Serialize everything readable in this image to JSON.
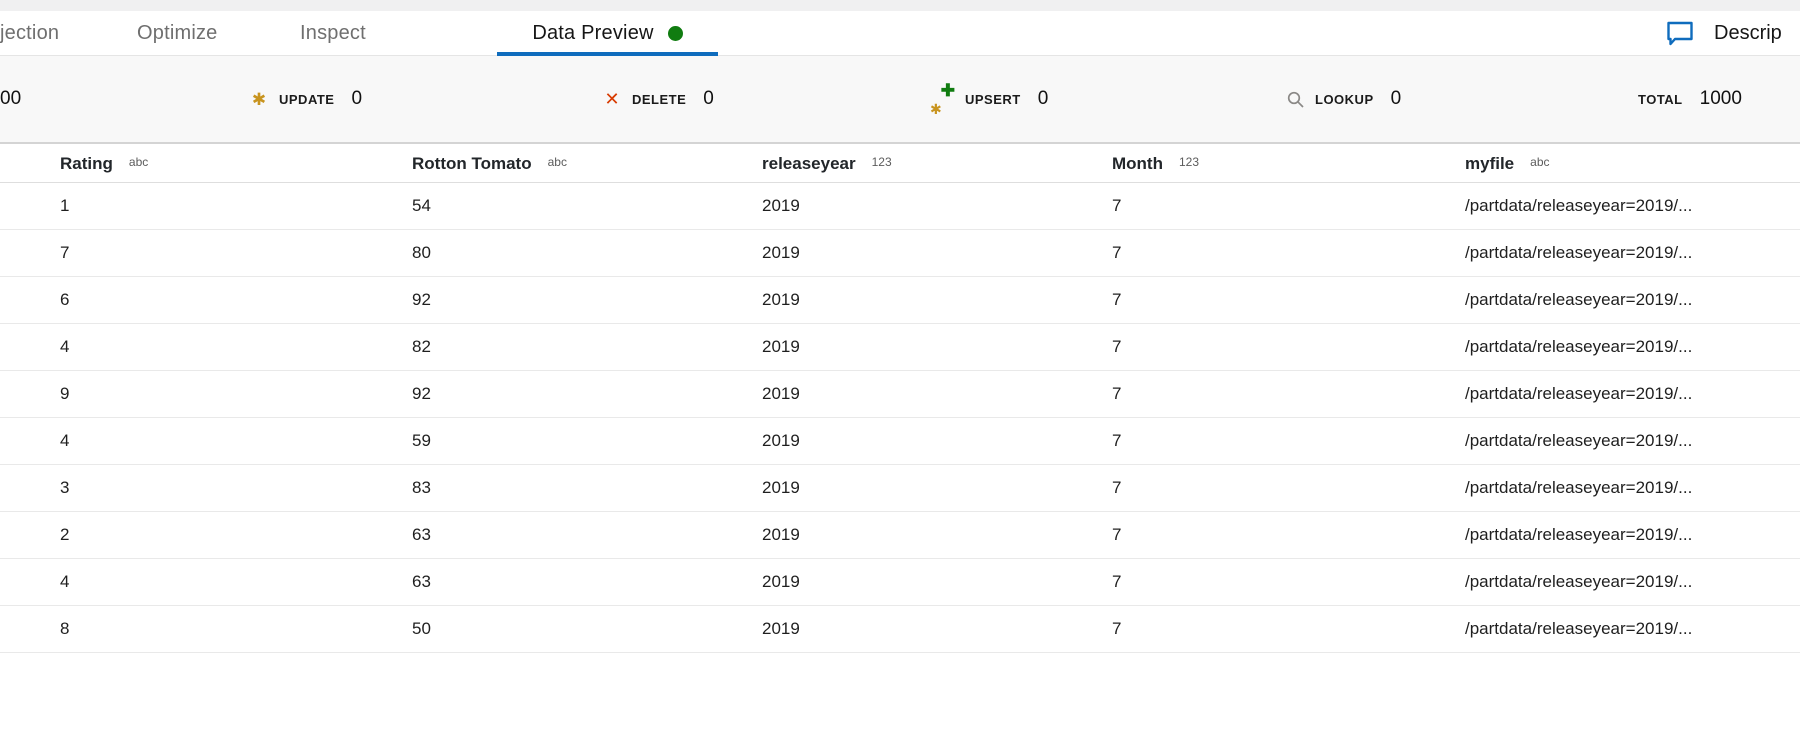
{
  "tabs": {
    "items": [
      {
        "label": "jection",
        "active": false
      },
      {
        "label": "Optimize",
        "active": false
      },
      {
        "label": "Inspect",
        "active": false
      },
      {
        "label": "Data Preview",
        "active": true,
        "has_status_dot": true
      }
    ],
    "description_button": {
      "label": "Descrip",
      "icon": "comment-icon"
    }
  },
  "stats": {
    "insert_count_partial": "00",
    "items": [
      {
        "label": "UPDATE",
        "count": "0",
        "icon": "asterisk-icon"
      },
      {
        "label": "DELETE",
        "count": "0",
        "icon": "x-icon"
      },
      {
        "label": "UPSERT",
        "count": "0",
        "icon": "asterisk-plus-icon"
      },
      {
        "label": "LOOKUP",
        "count": "0",
        "icon": "magnifier-icon"
      }
    ],
    "total": {
      "label": "TOTAL",
      "count": "1000"
    }
  },
  "table": {
    "columns": [
      {
        "name": "Rating",
        "type": "abc"
      },
      {
        "name": "Rotton Tomato",
        "type": "abc"
      },
      {
        "name": "releaseyear",
        "type": "123"
      },
      {
        "name": "Month",
        "type": "123"
      },
      {
        "name": "myfile",
        "type": "abc"
      }
    ],
    "rows": [
      [
        "1",
        "54",
        "2019",
        "7",
        "/partdata/releaseyear=2019/..."
      ],
      [
        "7",
        "80",
        "2019",
        "7",
        "/partdata/releaseyear=2019/..."
      ],
      [
        "6",
        "92",
        "2019",
        "7",
        "/partdata/releaseyear=2019/..."
      ],
      [
        "4",
        "82",
        "2019",
        "7",
        "/partdata/releaseyear=2019/..."
      ],
      [
        "9",
        "92",
        "2019",
        "7",
        "/partdata/releaseyear=2019/..."
      ],
      [
        "4",
        "59",
        "2019",
        "7",
        "/partdata/releaseyear=2019/..."
      ],
      [
        "3",
        "83",
        "2019",
        "7",
        "/partdata/releaseyear=2019/..."
      ],
      [
        "2",
        "63",
        "2019",
        "7",
        "/partdata/releaseyear=2019/..."
      ],
      [
        "4",
        "63",
        "2019",
        "7",
        "/partdata/releaseyear=2019/..."
      ],
      [
        "8",
        "50",
        "2019",
        "7",
        "/partdata/releaseyear=2019/..."
      ]
    ]
  },
  "colors": {
    "accent_blue": "#0f6cbd",
    "status_green": "#107c10",
    "update_gold": "#c8941f",
    "delete_red": "#d83b01",
    "lookup_gray": "#8a8886"
  }
}
